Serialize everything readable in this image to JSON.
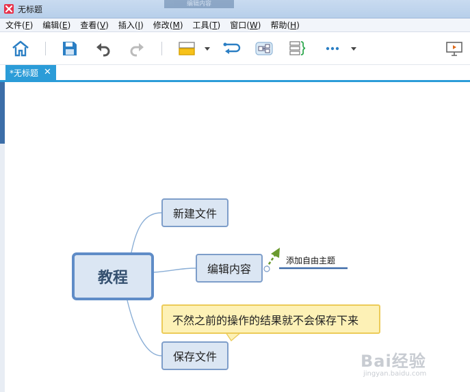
{
  "window": {
    "title": "无标题",
    "app_icon": "xmind-x-icon",
    "background_ghost_tab": "编辑内容"
  },
  "menu": [
    {
      "label": "文件(",
      "key": "F",
      "end": ")"
    },
    {
      "label": "编辑(",
      "key": "E",
      "end": ")"
    },
    {
      "label": "查看(",
      "key": "V",
      "end": ")"
    },
    {
      "label": "插入(",
      "key": "I",
      "end": ")"
    },
    {
      "label": "修改(",
      "key": "M",
      "end": ")"
    },
    {
      "label": "工具(",
      "key": "T",
      "end": ")"
    },
    {
      "label": "窗口(",
      "key": "W",
      "end": ")"
    },
    {
      "label": "帮助(",
      "key": "H",
      "end": ")"
    }
  ],
  "toolbar": {
    "icons": [
      "home-icon",
      "save-icon",
      "undo-icon",
      "redo-icon",
      "topic-style-icon",
      "dropdown-arrow-icon",
      "relationship-icon",
      "boundary-icon",
      "summary-icon",
      "more-icon",
      "dropdown-arrow-icon",
      "presentation-icon"
    ]
  },
  "tab": {
    "label": "*无标题",
    "close": "✕"
  },
  "mindmap": {
    "central": "教程",
    "topics": [
      "新建文件",
      "编辑内容",
      "保存文件"
    ],
    "floating_topic": "添加自由主题",
    "callout": "不然之前的操作的结果就不会保存下来"
  },
  "watermark": {
    "brand": "Bai经验",
    "url": "jingyan.baidu.com"
  },
  "colors": {
    "accent": "#2b9cd8",
    "central_border": "#5f8cc7",
    "topic_fill": "#dbe6f3",
    "callout_fill": "#fdf1b6",
    "drag_arrow": "#6a9a2e"
  }
}
